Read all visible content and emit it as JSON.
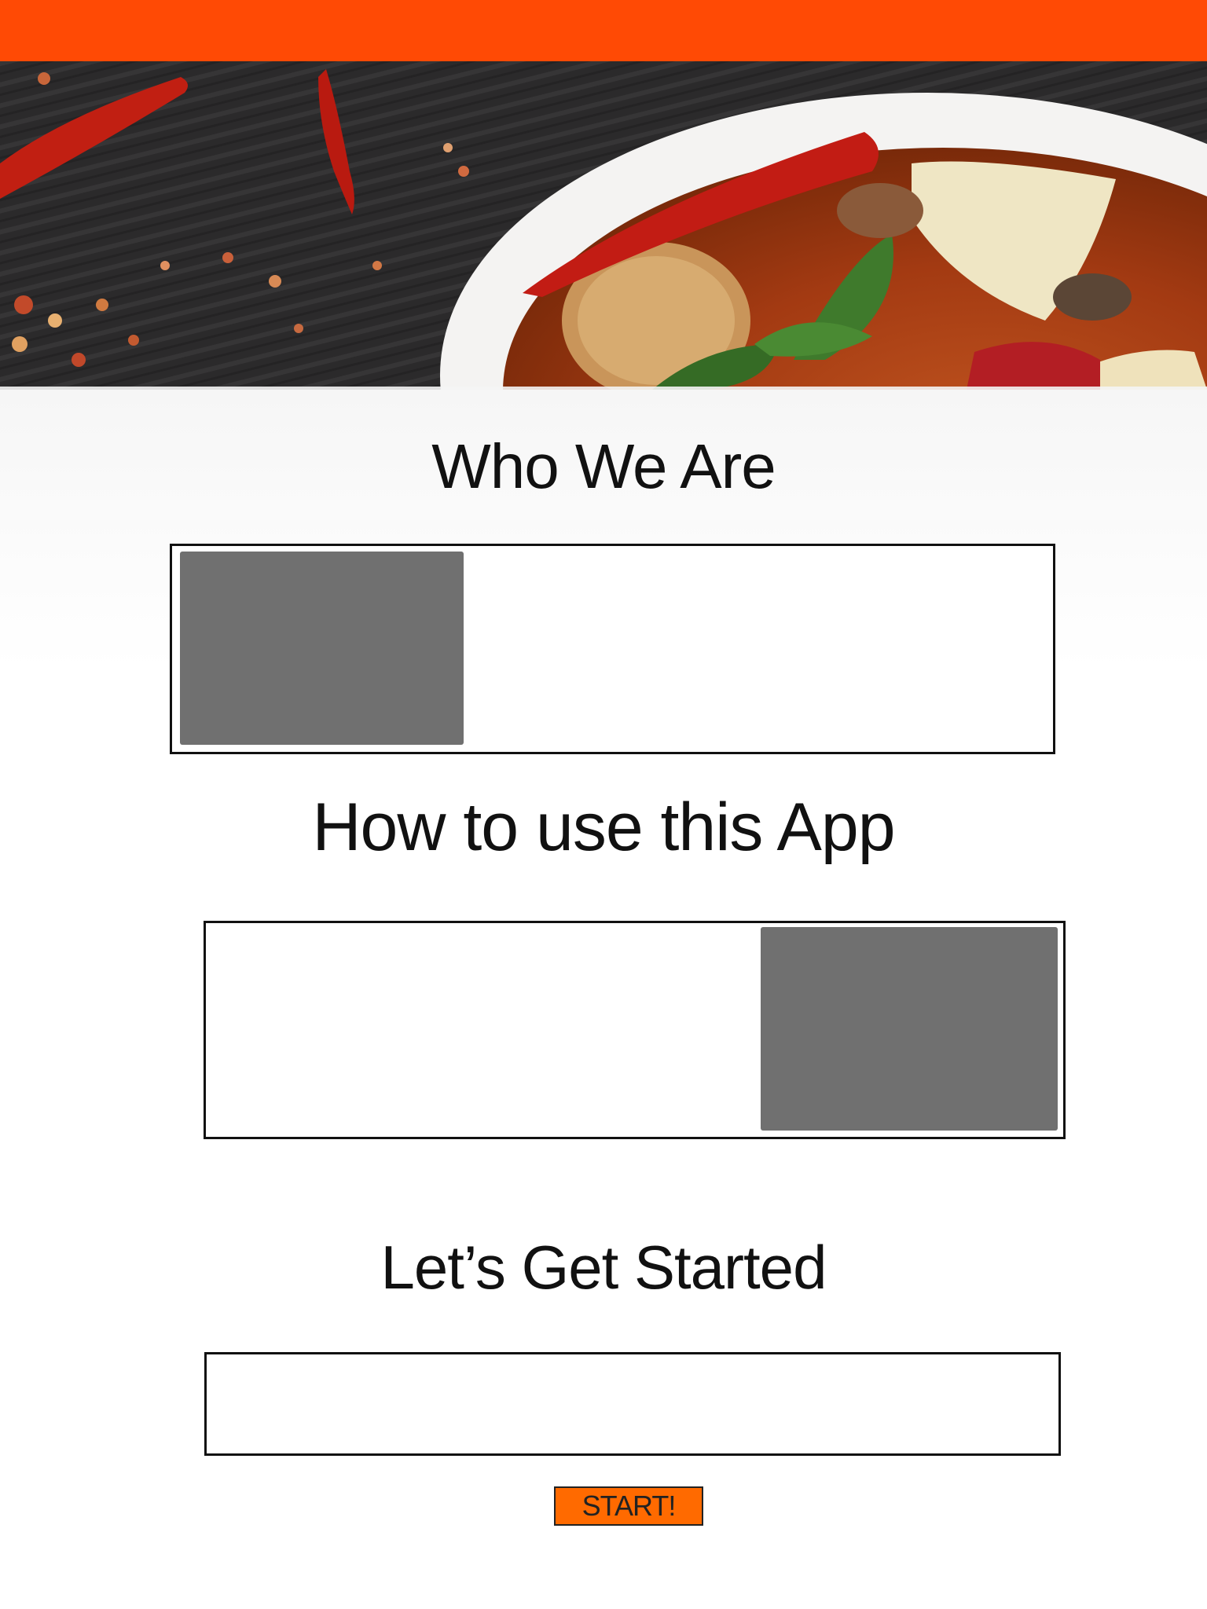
{
  "header": {
    "accent_color": "#ff4a05"
  },
  "hero": {
    "image_subject": "curry-bowl-with-chilies",
    "icon": "hero-food-image"
  },
  "sections": {
    "who_we_are": {
      "title": "Who We Are"
    },
    "how_to_use": {
      "title": "How to use this App"
    },
    "get_started": {
      "title": "Let’s Get Started"
    }
  },
  "actions": {
    "start_label": "START!",
    "start_color": "#ff6a00"
  }
}
